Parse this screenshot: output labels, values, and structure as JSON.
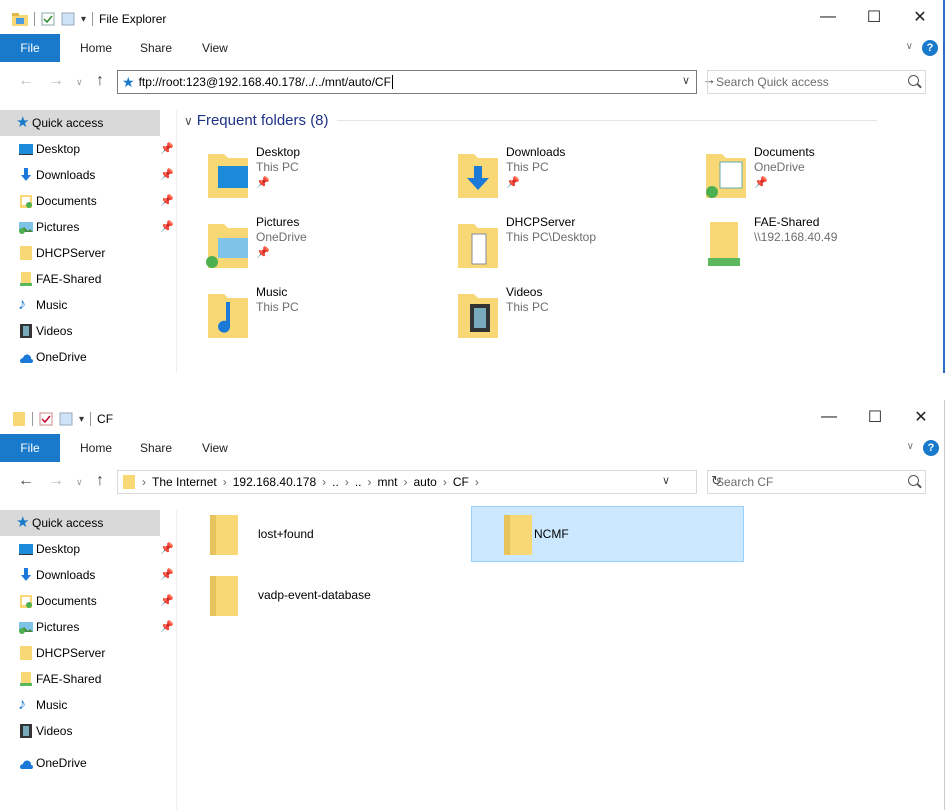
{
  "window1": {
    "title": "File Explorer",
    "ribbon_tabs": [
      "File",
      "Home",
      "Share",
      "View"
    ],
    "address": "ftp://root:123@192.168.40.178/../../mnt/auto/CF",
    "search_placeholder": "Search Quick access",
    "group_header": "Frequent folders (8)",
    "sidebar": [
      {
        "label": "Quick access",
        "icon": "star-icon",
        "pinned": false
      },
      {
        "label": "Desktop",
        "icon": "desktop-icon",
        "pinned": true
      },
      {
        "label": "Downloads",
        "icon": "downloads-icon",
        "pinned": true
      },
      {
        "label": "Documents",
        "icon": "documents-icon",
        "pinned": true
      },
      {
        "label": "Pictures",
        "icon": "pictures-icon",
        "pinned": true
      },
      {
        "label": "DHCPServer",
        "icon": "folder-icon",
        "pinned": false
      },
      {
        "label": "FAE-Shared",
        "icon": "network-folder-icon",
        "pinned": false
      },
      {
        "label": "Music",
        "icon": "music-icon",
        "pinned": false
      },
      {
        "label": "Videos",
        "icon": "videos-icon",
        "pinned": false
      },
      {
        "label": "OneDrive",
        "icon": "onedrive-icon",
        "pinned": false
      }
    ],
    "tiles": [
      {
        "name": "Desktop",
        "sub": "This PC",
        "pinned": true
      },
      {
        "name": "Downloads",
        "sub": "This PC",
        "pinned": true
      },
      {
        "name": "Documents",
        "sub": "OneDrive",
        "pinned": true
      },
      {
        "name": "Pictures",
        "sub": "OneDrive",
        "pinned": true
      },
      {
        "name": "DHCPServer",
        "sub": "This PC\\Desktop",
        "pinned": false
      },
      {
        "name": "FAE-Shared",
        "sub": "\\\\192.168.40.49",
        "pinned": false
      },
      {
        "name": "Music",
        "sub": "This PC",
        "pinned": false
      },
      {
        "name": "Videos",
        "sub": "This PC",
        "pinned": false
      }
    ]
  },
  "window2": {
    "title": "CF",
    "ribbon_tabs": [
      "File",
      "Home",
      "Share",
      "View"
    ],
    "breadcrumb": [
      "The Internet",
      "192.168.40.178",
      "..",
      "..",
      "mnt",
      "auto",
      "CF"
    ],
    "search_placeholder": "Search CF",
    "sidebar": [
      {
        "label": "Quick access",
        "icon": "star-icon",
        "pinned": false
      },
      {
        "label": "Desktop",
        "icon": "desktop-icon",
        "pinned": true
      },
      {
        "label": "Downloads",
        "icon": "downloads-icon",
        "pinned": true
      },
      {
        "label": "Documents",
        "icon": "documents-icon",
        "pinned": true
      },
      {
        "label": "Pictures",
        "icon": "pictures-icon",
        "pinned": true
      },
      {
        "label": "DHCPServer",
        "icon": "folder-icon",
        "pinned": false
      },
      {
        "label": "FAE-Shared",
        "icon": "network-folder-icon",
        "pinned": false
      },
      {
        "label": "Music",
        "icon": "music-icon",
        "pinned": false
      },
      {
        "label": "Videos",
        "icon": "videos-icon",
        "pinned": false
      },
      {
        "label": "OneDrive",
        "icon": "onedrive-icon",
        "pinned": false
      }
    ],
    "items": [
      {
        "name": "lost+found",
        "selected": false
      },
      {
        "name": "NCMF",
        "selected": true
      },
      {
        "name": "vadp-event-database",
        "selected": false
      }
    ]
  },
  "colors": {
    "accent": "#1979ca",
    "selection": "#cce8ff",
    "folder": "#f8d775",
    "header_text": "#1e3287"
  }
}
